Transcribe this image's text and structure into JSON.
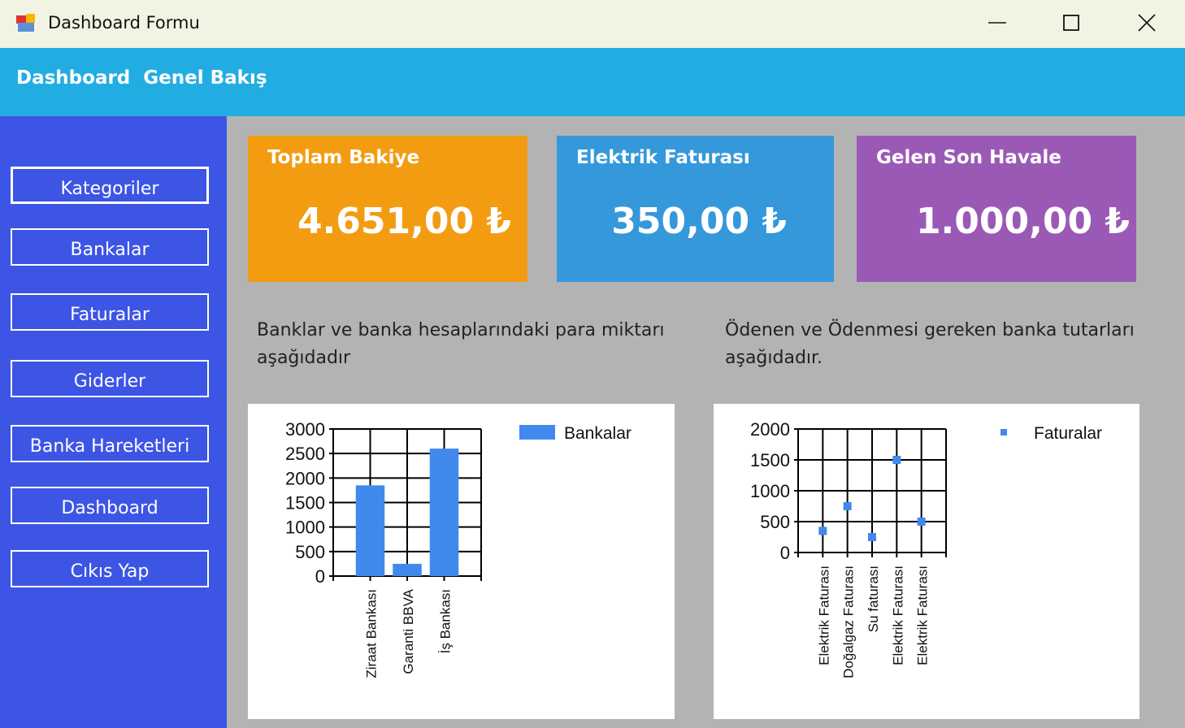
{
  "window": {
    "title": "Dashboard Formu"
  },
  "header": {
    "title": "Dashboard  Genel Bakış"
  },
  "sidebar": {
    "items": [
      {
        "label": "Kategoriler"
      },
      {
        "label": "Bankalar"
      },
      {
        "label": "Faturalar"
      },
      {
        "label": "Giderler"
      },
      {
        "label": "Banka Hareketleri"
      },
      {
        "label": "Dashboard"
      },
      {
        "label": "Cıkıs Yap"
      }
    ]
  },
  "cards": [
    {
      "label": "Toplam Bakiye",
      "value": "4.651,00 ₺",
      "color": "#f39c12"
    },
    {
      "label": "Elektrik Faturası",
      "value": "350,00 ₺",
      "color": "#3498db"
    },
    {
      "label": "Gelen Son Havale",
      "value": "1.000,00 ₺",
      "color": "#9b59b6"
    }
  ],
  "descriptions": {
    "left": "Banklar ve banka hesaplarındaki para miktarı aşağıdadır",
    "right": "Ödenen ve Ödenmesi gereken banka tutarları aşağıdadır."
  },
  "chart_data": [
    {
      "type": "bar",
      "legend": "Bankalar",
      "categories": [
        "Ziraat Bankası",
        "Garanti BBVA",
        "İş Bankası"
      ],
      "values": [
        1850,
        250,
        2600
      ],
      "ylim": [
        0,
        3000
      ],
      "yticks": [
        "0",
        "500",
        "1000",
        "1500",
        "2000",
        "2500",
        "3000"
      ],
      "color": "#4189ec",
      "grid": true,
      "legend_position": "top-right"
    },
    {
      "type": "scatter",
      "legend": "Faturalar",
      "categories": [
        "Elektrik Faturası",
        "Doğalgaz Faturası",
        "Su faturası",
        "Elektrik Faturası",
        "Elektrik Faturası"
      ],
      "values": [
        350,
        750,
        250,
        1500,
        500
      ],
      "ylim": [
        0,
        2000
      ],
      "yticks": [
        "0",
        "500",
        "1000",
        "1500",
        "2000"
      ],
      "color": "#4189ec",
      "grid": true,
      "legend_position": "top-right"
    }
  ]
}
